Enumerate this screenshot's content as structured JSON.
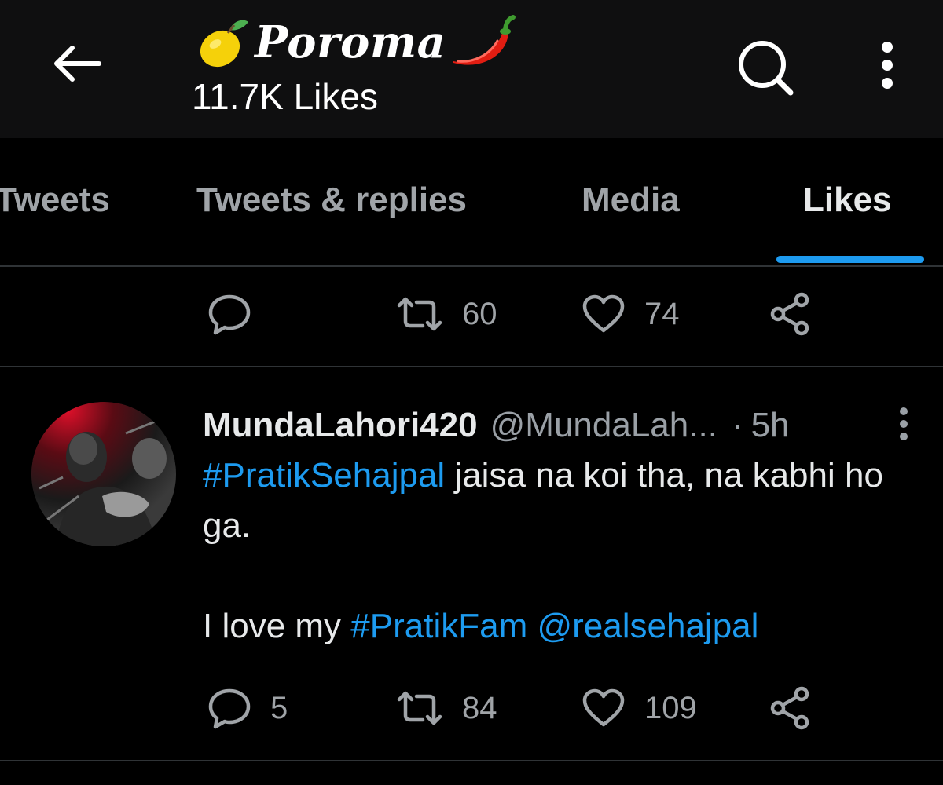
{
  "header": {
    "title": "Poroma",
    "subtitle": "11.7K Likes",
    "title_left_icon": "lemon-emoji",
    "title_right_icon": "chili-pepper-emoji"
  },
  "tabs": [
    {
      "label": "Tweets"
    },
    {
      "label": "Tweets & replies"
    },
    {
      "label": "Media"
    },
    {
      "label": "Likes",
      "active": true
    }
  ],
  "previous_tweet_actions": {
    "reply": "",
    "retweet": "60",
    "like": "74"
  },
  "tweet": {
    "author_name": "MundaLahori420",
    "handle": "@MundaLah...",
    "separator": "·",
    "time": "5h",
    "hashtag_1": "#PratikSehajpal",
    "text_1": " jaisa na koi tha, na kabhi ho ga.",
    "text_2": "I love my ",
    "hashtag_2": "#PratikFam",
    "mention": "@realsehajpal",
    "actions": {
      "reply": "5",
      "retweet": "84",
      "like": "109"
    }
  },
  "colors": {
    "accent": "#1d9bf0",
    "background": "#000000",
    "header_background": "#0f0f10",
    "secondary_text": "#9aa0a6"
  }
}
